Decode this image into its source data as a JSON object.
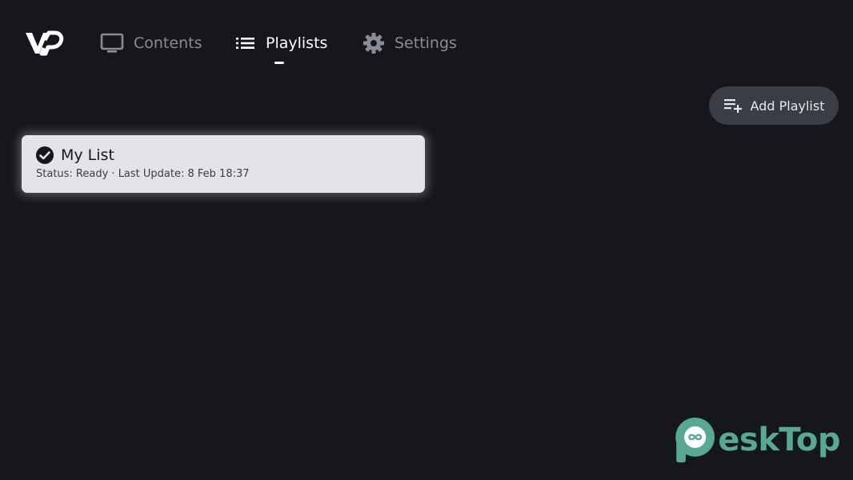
{
  "nav": {
    "contents_label": "Contents",
    "playlists_label": "Playlists",
    "settings_label": "Settings",
    "active": "playlists"
  },
  "toolbar": {
    "add_playlist_label": "Add Playlist"
  },
  "playlists": [
    {
      "name": "My List",
      "status_line": "Status: Ready · Last Update: 8 Feb 18:37",
      "selected": true
    }
  ],
  "watermark": {
    "text": "esktop",
    "display_text": "eskTop"
  },
  "colors": {
    "background": "#15171c",
    "card": "#e3e4e8",
    "button": "#3a3d44",
    "inactive_text": "#8a8d93",
    "watermark": "#58a994"
  }
}
